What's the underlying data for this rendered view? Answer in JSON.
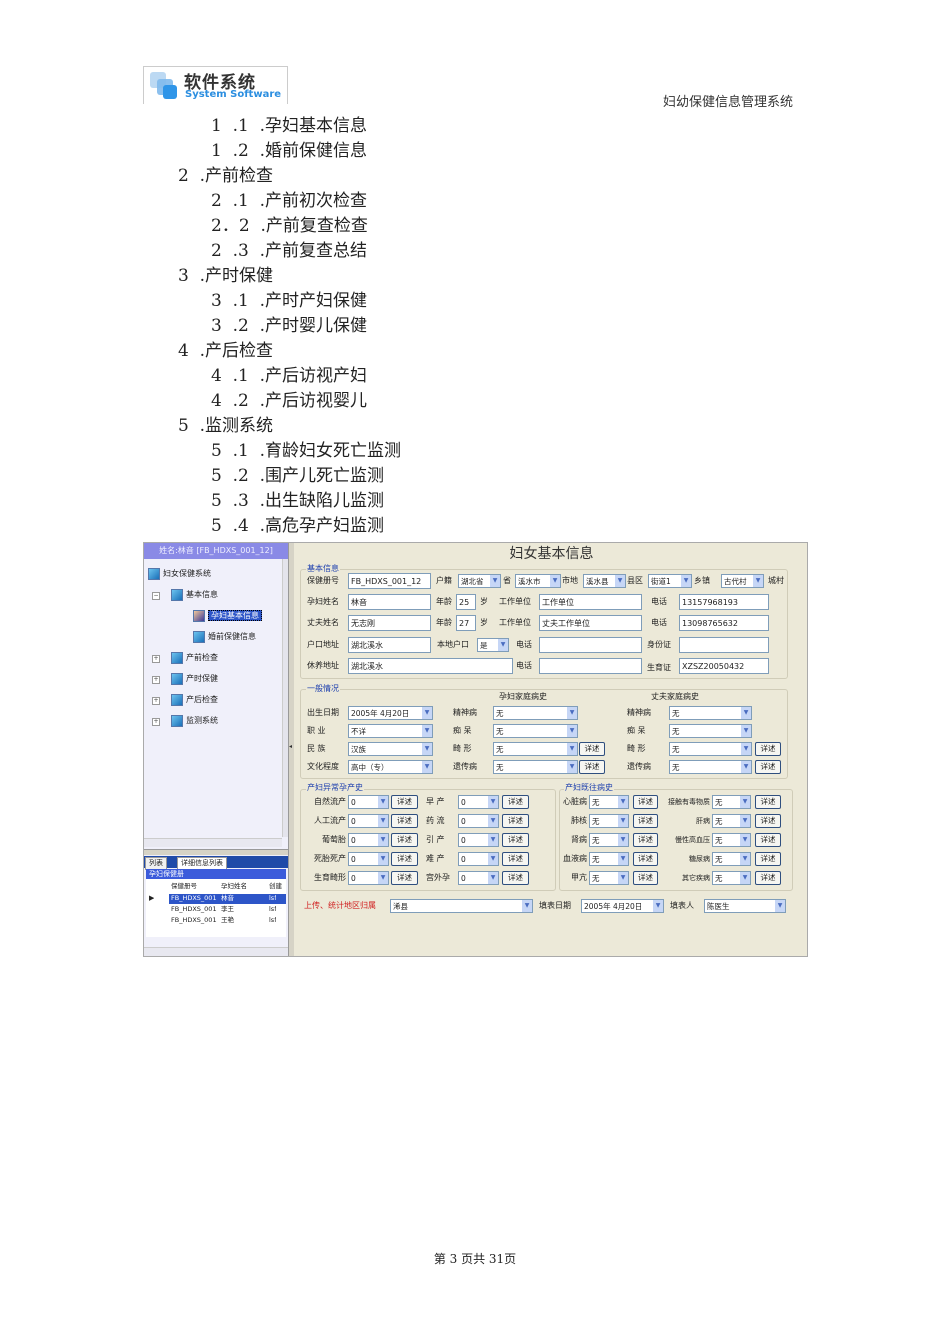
{
  "header": {
    "logo_cn": "软件系统",
    "logo_en": "System Software",
    "doc_title": "妇幼保健信息管理系统"
  },
  "outline": [
    "1  .1  .孕妇基本信息",
    "1  .2  .婚前保健信息",
    "2  .产前检查",
    "2  .1  .产前初次检查",
    "2．2  .产前复查检查",
    "2  .3  .产前复查总结",
    "3  .产时保健",
    "3  .1  .产时产妇保健",
    "3  .2  .产时婴儿保健",
    "4  .产后检查",
    "4  .1  .产后访视产妇",
    "4  .2  .产后访视婴儿",
    "5  .监测系统",
    "5  .1  .育龄妇女死亡监测",
    "5  .2  .围产儿死亡监测",
    "5  .3  .出生缺陷儿监测",
    "5  .4  .高危孕产妇监测"
  ],
  "left": {
    "header": "姓名:林音 [FB_HDXS_001_12]",
    "tree": [
      "妇女保健系统",
      "基本信息",
      "孕妇基本信息",
      "婚前保健信息",
      "产前检查",
      "产时保健",
      "产后检查",
      "监测系统"
    ],
    "tabs": [
      "列表",
      "详细信息列表"
    ],
    "grid_title": "孕妇保健册",
    "columns": [
      "保健册号",
      "孕妇姓名",
      "创建"
    ],
    "rows": [
      [
        "FB_HDXS_001",
        "林音",
        "lsf"
      ],
      [
        "FB_HDXS_001",
        "李王",
        "lsf"
      ],
      [
        "FB_HDXS_001",
        "王艳",
        "lsf"
      ]
    ]
  },
  "form": {
    "title": "妇女基本信息",
    "basic": {
      "legend": "基本信息",
      "record_no_label": "保健册号",
      "record_no": "FB_HDXS_001_12",
      "huji_label": "户籍",
      "province": "湖北省",
      "province_suffix": "省",
      "city": "溪水市",
      "city_suffix": "市地",
      "county": "溪水县",
      "county_suffix": "县区",
      "street": "街道1",
      "street_suffix": "乡镇",
      "village": "古代村",
      "village_suffix": "城村",
      "name_label": "孕妇姓名",
      "name": "林音",
      "age_label": "年龄",
      "age": "25",
      "age_unit": "岁",
      "work_label": "工作单位",
      "work": "工作单位",
      "phone_label": "电话",
      "phone": "13157968193",
      "husband_label": "丈夫姓名",
      "husband": "无志刚",
      "husband_age": "27",
      "husband_work": "丈夫工作单位",
      "husband_phone": "13098765632",
      "hukou_addr_label": "户口地址",
      "hukou_addr": "湖北溪水",
      "local_label": "本地户口",
      "local": "是",
      "tel_label": "电话",
      "tel": "",
      "id_label": "身份证",
      "id": "",
      "rest_addr_label": "休养地址",
      "rest_addr": "湖北溪水",
      "tel2": "",
      "birth_cert_label": "生育证",
      "birth_cert": "XZSZ20050432"
    },
    "general": {
      "legend": "一般情况",
      "wife_history": "孕妇家庭病史",
      "husband_history": "丈夫家庭病史",
      "birth_label": "出生日期",
      "birth": "2005年  4月20日",
      "job_label": "职    业",
      "job": "不详",
      "nation_label": "民    族",
      "nation": "汉族",
      "edu_label": "文化程度",
      "edu": "高中（专）",
      "diseases": [
        "精神病",
        "痴    呆",
        "畸    形",
        "遗传病"
      ],
      "wife_values": [
        "无",
        "无",
        "无",
        "无"
      ],
      "husband_values": [
        "无",
        "无",
        "无",
        "无"
      ],
      "detail": "详述"
    },
    "abnormal": {
      "legend": "产妇异常孕产史",
      "left_labels": [
        "自然流产",
        "人工流产",
        "葡萄胎",
        "死胎死产",
        "生育畸形"
      ],
      "left_values": [
        "0",
        "0",
        "0",
        "0",
        "0"
      ],
      "right_labels": [
        "早    产",
        "药    流",
        "引    产",
        "难    产",
        "宫外孕"
      ],
      "right_values": [
        "0",
        "0",
        "0",
        "0",
        "0"
      ]
    },
    "past": {
      "legend": "产妇既往病史",
      "left_labels": [
        "心脏病",
        "肺核",
        "肾病",
        "血液病",
        "甲亢"
      ],
      "left_values": [
        "无",
        "无",
        "无",
        "无",
        "无"
      ],
      "right_labels": [
        "接触有毒物质",
        "肝病",
        "慢性高血压",
        "糖尿病",
        "其它疾病"
      ],
      "right_values": [
        "无",
        "无",
        "无",
        "无",
        "无"
      ]
    },
    "bottom": {
      "region_label": "上传、统计地区归属",
      "region": "浠县",
      "date_label": "填表日期",
      "date": "2005年  4月20日",
      "filler_label": "填表人",
      "filler": "陈医生"
    }
  },
  "footer": "第  3  页共  31页"
}
